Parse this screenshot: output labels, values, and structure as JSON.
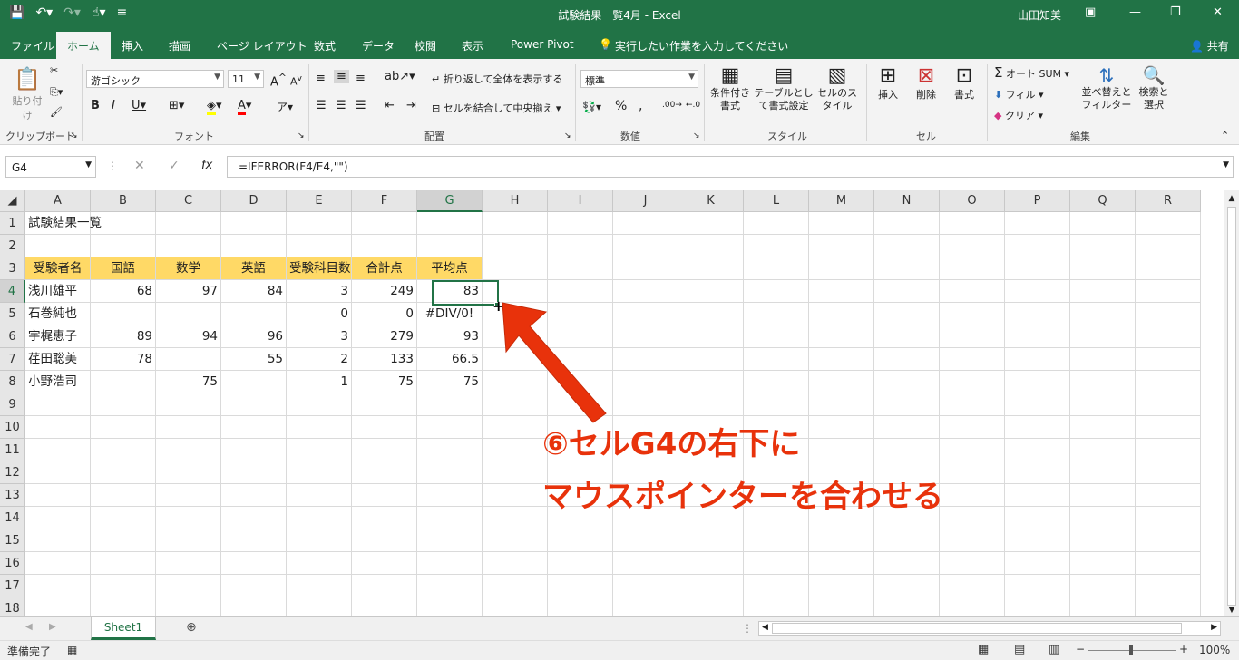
{
  "window": {
    "title": "試験結果一覧4月  -  Excel",
    "user": "山田知美"
  },
  "tabs": [
    "ファイル",
    "ホーム",
    "挿入",
    "描画",
    "ページ レイアウト",
    "数式",
    "データ",
    "校閲",
    "表示",
    "Power Pivot",
    "実行したい作業を入力してください",
    "共有"
  ],
  "ribbon": {
    "clipboard": {
      "paste": "貼り付け",
      "label": "クリップボード"
    },
    "font": {
      "name": "游ゴシック",
      "size": "11",
      "label": "フォント"
    },
    "alignment": {
      "wrap": "折り返して全体を表示する",
      "merge": "セルを結合して中央揃え",
      "label": "配置"
    },
    "number": {
      "format": "標準",
      "label": "数値"
    },
    "styles": {
      "conditional": "条件付き書式",
      "table": "テーブルとして書式設定",
      "cell": "セルのスタイル",
      "label": "スタイル"
    },
    "cells": {
      "insert": "挿入",
      "delete": "削除",
      "format": "書式",
      "label": "セル"
    },
    "editing": {
      "autosum": "オート SUM",
      "fill": "フィル",
      "clear": "クリア",
      "sort": "並べ替えとフィルター",
      "find": "検索と選択",
      "label": "編集"
    }
  },
  "formula": {
    "namebox": "G4",
    "content": "=IFERROR(F4/E4,\"\")"
  },
  "columns": [
    "A",
    "B",
    "C",
    "D",
    "E",
    "F",
    "G",
    "H",
    "I",
    "J",
    "K",
    "L",
    "M",
    "N",
    "O",
    "P",
    "Q",
    "R"
  ],
  "rows": [
    "1",
    "2",
    "3",
    "4",
    "5",
    "6",
    "7",
    "8",
    "9",
    "10",
    "11",
    "12",
    "13",
    "14",
    "15",
    "16",
    "17",
    "18"
  ],
  "sheet": {
    "title": "試験結果一覧",
    "headers": [
      "受験者名",
      "国語",
      "数学",
      "英語",
      "受験科目数",
      "合計点",
      "平均点"
    ],
    "data": [
      [
        "浅川雄平",
        "68",
        "97",
        "84",
        "3",
        "249",
        "83"
      ],
      [
        "石巻純也",
        "",
        "",
        "",
        "0",
        "0",
        "#DIV/0!"
      ],
      [
        "宇梶恵子",
        "89",
        "94",
        "96",
        "3",
        "279",
        "93"
      ],
      [
        "荏田聡美",
        "78",
        "",
        "55",
        "2",
        "133",
        "66.5"
      ],
      [
        "小野浩司",
        "",
        "75",
        "",
        "1",
        "75",
        "75"
      ]
    ]
  },
  "annotation": {
    "line1": "⑥セルG4の右下に",
    "line2": "マウスポインターを合わせる"
  },
  "sheet_tab": "Sheet1",
  "status": {
    "ready": "準備完了",
    "zoom": "100%"
  },
  "colors": {
    "excel_green": "#217346",
    "header_fill": "#ffd966",
    "annotation": "#e8320b"
  }
}
